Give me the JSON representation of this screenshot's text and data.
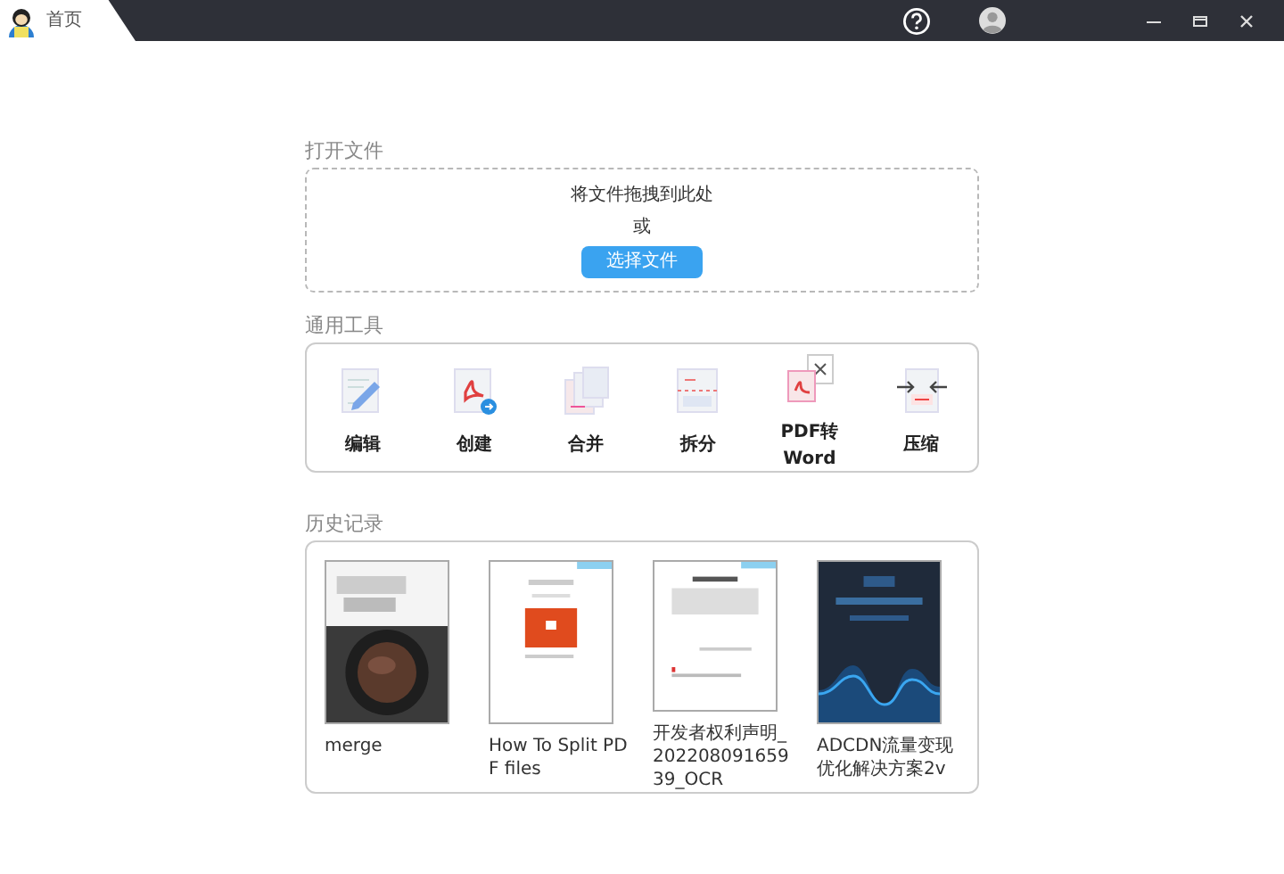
{
  "window": {
    "tab": {
      "label": "首页",
      "selected": true
    }
  },
  "open_file": {
    "title": "打开文件",
    "drop_text": "将文件拖拽到此处",
    "or_text": "或",
    "button": "选择文件"
  },
  "tools": {
    "title": "通用工具",
    "items": [
      {
        "label": "编辑"
      },
      {
        "label": "创建"
      },
      {
        "label": "合并"
      },
      {
        "label": "拆分"
      },
      {
        "label": "PDF转Word"
      },
      {
        "label": "压缩"
      }
    ]
  },
  "history": {
    "title": "历史记录",
    "items": [
      {
        "name": "merge"
      },
      {
        "name": "How To Split PDF files"
      },
      {
        "name": "开发者权利声明_20220809165939_OCR"
      },
      {
        "name": "ADCDN流量变现优化解决方案2v"
      }
    ]
  }
}
